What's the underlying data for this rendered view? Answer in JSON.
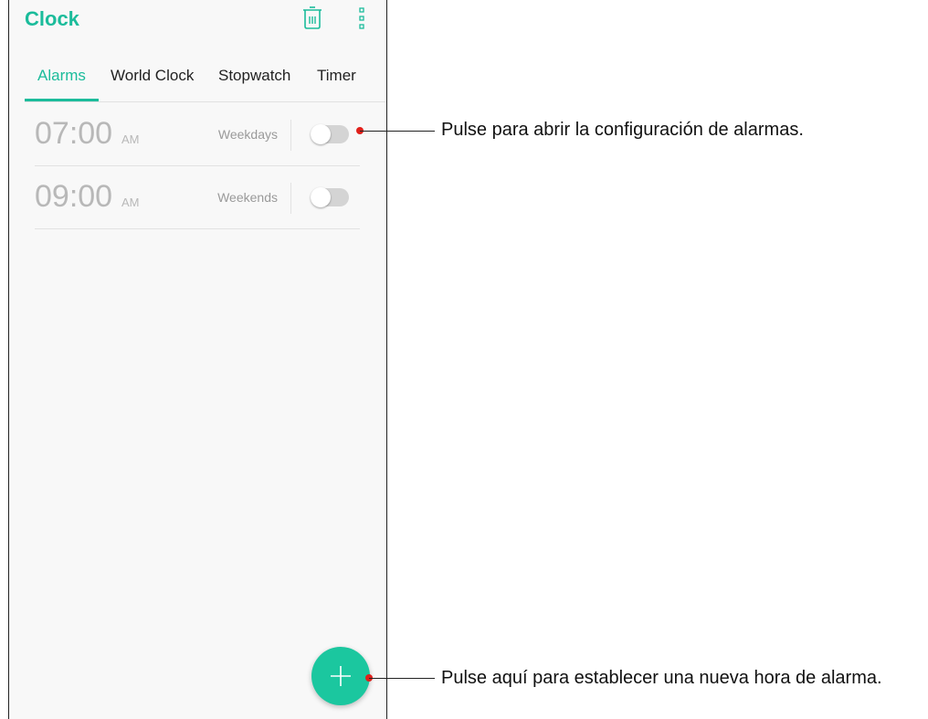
{
  "app": {
    "title": "Clock"
  },
  "icons": {
    "delete": "trash-icon",
    "menu": "more-vert-icon",
    "add": "plus-icon"
  },
  "tabs": [
    {
      "label": "Alarms",
      "active": true
    },
    {
      "label": "World Clock",
      "active": false
    },
    {
      "label": "Stopwatch",
      "active": false
    },
    {
      "label": "Timer",
      "active": false
    }
  ],
  "alarms": [
    {
      "time": "07:00",
      "ampm": "AM",
      "repeat": "Weekdays",
      "enabled": false
    },
    {
      "time": "09:00",
      "ampm": "AM",
      "repeat": "Weekends",
      "enabled": false
    }
  ],
  "callouts": {
    "alarm_settings": "Pulse para abrir la configuración de alarmas.",
    "new_alarm": "Pulse aquí para establecer una nueva hora de alarma."
  },
  "colors": {
    "accent": "#1bbc9b",
    "fab": "#1bc79f",
    "callout_dot": "#e0201b"
  }
}
